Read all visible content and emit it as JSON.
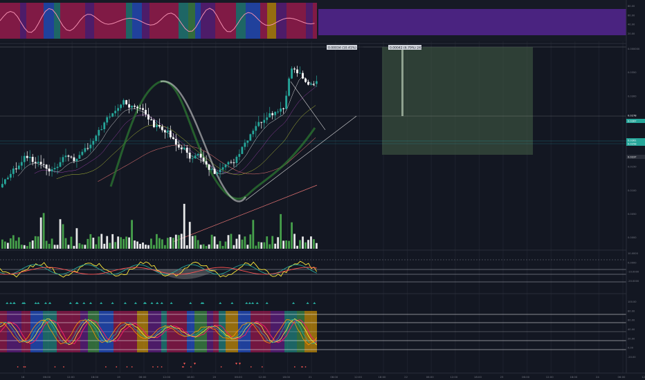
{
  "chart_data": [
    {
      "type": "heatmap-oscillator",
      "panel": "top-oscillator",
      "scale_labels": [
        "80.00",
        "60.00",
        "40.00",
        "20.00"
      ],
      "band_colors": [
        "#d81b60",
        "#7b1fa2",
        "#2962ff",
        "#26a69a",
        "#4caf50",
        "#ffb300"
      ],
      "line_color": "#f48fb1"
    },
    {
      "type": "candlestick",
      "panel": "main-price",
      "colors": {
        "up": "#26a69a",
        "down": "#ffffff",
        "volume_up": "#4caf50",
        "volume_down": "#ffffff",
        "fill_zone": "#415a45"
      },
      "price_axis_labels": [
        "0.000000",
        "0.0350",
        "0.0300",
        "0.0250",
        "0.0200",
        "0.0150",
        "0.0100",
        "0.0050",
        "0.0000"
      ],
      "order_tags": {
        "entry": "0.00034 (10.41%) 340",
        "target": "0.00042 (6.79%) 243"
      },
      "right_tags": [
        "0.0278",
        "0.0267",
        "0.0261",
        "0.0258",
        "0.0237"
      ],
      "volume_scale_label": "0.000"
    },
    {
      "type": "line",
      "panel": "middle-oscillator",
      "scale_labels": [
        "10.0000",
        "0.0000",
        "-10.0000",
        "-20.0000"
      ],
      "series_colors": [
        "#ffeb3b",
        "#26a69a",
        "#ff5252"
      ]
    },
    {
      "type": "heatmap-oscillator",
      "panel": "bottom-oscillator",
      "scale_labels": [
        "100.00",
        "80.00",
        "60.00",
        "40.00",
        "20.00",
        "0.00",
        "-20.00"
      ],
      "series_colors": [
        "#e91e63",
        "#ffeb3b",
        "#26a69a",
        "#ff9800"
      ],
      "band_colors": [
        "#c2185b",
        "#7b1fa2",
        "#2962ff",
        "#26a69a",
        "#4caf50",
        "#ffb300"
      ]
    }
  ],
  "x_axis_labels": [
    "18",
    "06:00",
    "12:00",
    "18:00",
    "19",
    "06:00",
    "12:00",
    "18:00",
    "20",
    "06:00",
    "12:00",
    "18:00",
    "21",
    "06:00",
    "12:00",
    "18:00",
    "22",
    "06:00",
    "12:00",
    "18:00",
    "23",
    "06:00",
    "12:00",
    "18:00",
    "24",
    "06:00",
    "12:00"
  ]
}
